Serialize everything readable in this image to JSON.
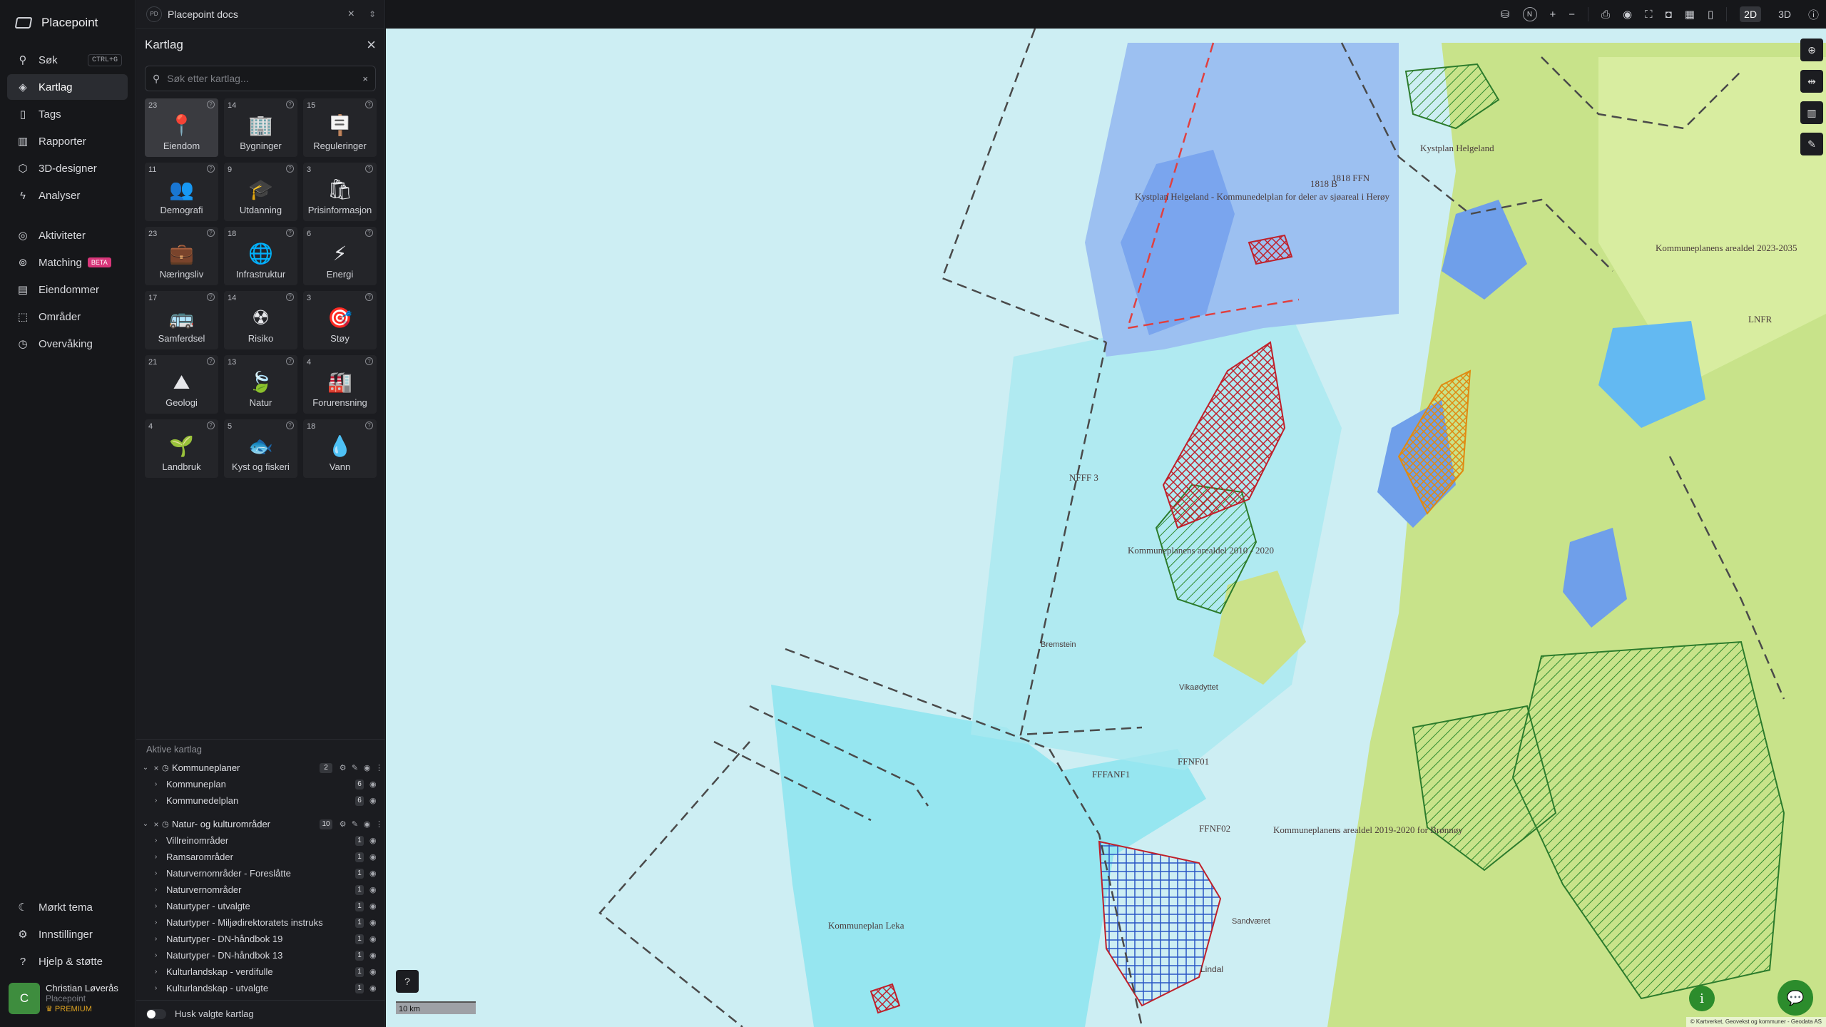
{
  "app": {
    "name": "Placepoint"
  },
  "nav": {
    "items": [
      {
        "label": "Søk",
        "shortcut": "CTRL+G"
      },
      {
        "label": "Kartlag"
      },
      {
        "label": "Tags"
      },
      {
        "label": "Rapporter"
      },
      {
        "label": "3D-designer"
      },
      {
        "label": "Analyser"
      }
    ],
    "items2": [
      {
        "label": "Aktiviteter"
      },
      {
        "label": "Matching",
        "badge": "BETA"
      },
      {
        "label": "Eiendommer"
      },
      {
        "label": "Områder"
      },
      {
        "label": "Overvåking"
      }
    ],
    "bottom": [
      {
        "label": "Mørkt tema"
      },
      {
        "label": "Innstillinger"
      },
      {
        "label": "Hjelp & støtte"
      }
    ],
    "user": {
      "initial": "C",
      "name": "Christian Løverås",
      "org": "Placepoint",
      "plan": "PREMIUM"
    }
  },
  "panel": {
    "project_badge": "PD",
    "project": "Placepoint docs",
    "title": "Kartlag",
    "search_placeholder": "Søk etter kartlag...",
    "categories": [
      {
        "count": "23",
        "label": "Eiendom",
        "icon": "📍"
      },
      {
        "count": "14",
        "label": "Bygninger",
        "icon": "🏢"
      },
      {
        "count": "15",
        "label": "Reguleringer",
        "icon": "🪧"
      },
      {
        "count": "11",
        "label": "Demografi",
        "icon": "👥"
      },
      {
        "count": "9",
        "label": "Utdanning",
        "icon": "🎓"
      },
      {
        "count": "3",
        "label": "Prisinformasjon",
        "icon": "🛍"
      },
      {
        "count": "23",
        "label": "Næringsliv",
        "icon": "💼"
      },
      {
        "count": "18",
        "label": "Infrastruktur",
        "icon": "🌐"
      },
      {
        "count": "6",
        "label": "Energi",
        "icon": "⚡"
      },
      {
        "count": "17",
        "label": "Samferdsel",
        "icon": "🚌"
      },
      {
        "count": "14",
        "label": "Risiko",
        "icon": "☢"
      },
      {
        "count": "3",
        "label": "Støy",
        "icon": "🎯"
      },
      {
        "count": "21",
        "label": "Geologi",
        "icon": "⛰"
      },
      {
        "count": "13",
        "label": "Natur",
        "icon": "🍃"
      },
      {
        "count": "4",
        "label": "Forurensning",
        "icon": "🏭"
      },
      {
        "count": "4",
        "label": "Landbruk",
        "icon": "🌱"
      },
      {
        "count": "5",
        "label": "Kyst og fiskeri",
        "icon": "🐟"
      },
      {
        "count": "18",
        "label": "Vann",
        "icon": "💧"
      }
    ],
    "active_title": "Aktive kartlag",
    "groups": [
      {
        "name": "Kommuneplaner",
        "count": "2",
        "subs": [
          {
            "name": "Kommuneplan",
            "count": "6"
          },
          {
            "name": "Kommunedelplan",
            "count": "6"
          }
        ]
      },
      {
        "name": "Natur- og kulturområder",
        "count": "10",
        "subs": [
          {
            "name": "Villreinområder",
            "count": "1"
          },
          {
            "name": "Ramsarområder",
            "count": "1"
          },
          {
            "name": "Naturvernområder - Foreslåtte",
            "count": "1"
          },
          {
            "name": "Naturvernområder",
            "count": "1"
          },
          {
            "name": "Naturtyper - utvalgte",
            "count": "1"
          },
          {
            "name": "Naturtyper - Miljødirektoratets instruks",
            "count": "1"
          },
          {
            "name": "Naturtyper - DN-håndbok 19",
            "count": "1"
          },
          {
            "name": "Naturtyper - DN-håndbok 13",
            "count": "1"
          },
          {
            "name": "Kulturlandskap - verdifulle",
            "count": "1"
          },
          {
            "name": "Kulturlandskap - utvalgte",
            "count": "1"
          }
        ]
      }
    ],
    "remember_label": "Husk valgte kartlag"
  },
  "topbar": {
    "north": "N",
    "mode_2d": "2D",
    "mode_3d": "3D"
  },
  "map": {
    "scale": "10 km",
    "labels": [
      "Kystplan Helgeland - Kommunedelplan for deler av sjøareal i Herøy",
      "Kommuneplanens arealdel 2010 - 2020",
      "Kommuneplan Leka",
      "Kommuneplanens arealdel 2019-2020 for Brønnøy",
      "Kommuneplanens arealdel 2023-2035",
      "Kystplan Helgeland",
      "Bremstein",
      "Vikaødyttet",
      "FFFANF1",
      "FFNF01",
      "FFNF02",
      "NFFF 3",
      "1818 B",
      "1818 FFN",
      "LNFR",
      "Sandværet",
      "Lindal"
    ],
    "attribution": "© Kartverket, Geovekst og kommuner - Geodata AS"
  },
  "colors": {
    "accent": "#2c8c2c",
    "sea": "#cdeef3",
    "land": "#c8e38a",
    "sidebar": "#16171a"
  }
}
